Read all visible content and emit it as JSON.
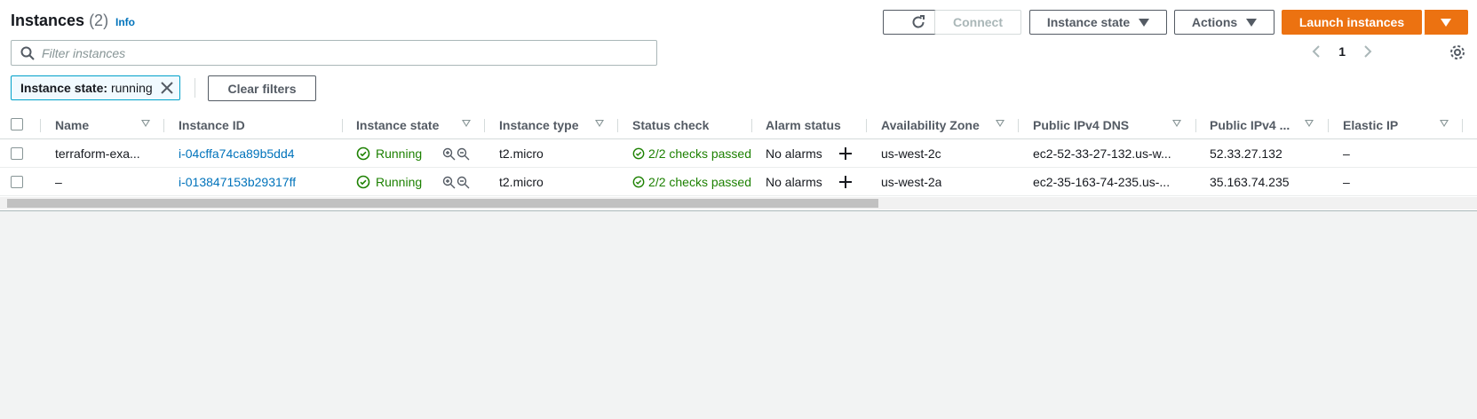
{
  "header": {
    "title": "Instances",
    "count": "(2)",
    "info": "Info"
  },
  "toolbar": {
    "connect": "Connect",
    "instance_state": "Instance state",
    "actions": "Actions",
    "launch": "Launch instances"
  },
  "search": {
    "placeholder": "Filter instances"
  },
  "pagination": {
    "page": "1"
  },
  "filter": {
    "key": "Instance state:",
    "value": "running",
    "clear": "Clear filters"
  },
  "columns": [
    "Name",
    "Instance ID",
    "Instance state",
    "Instance type",
    "Status check",
    "Alarm status",
    "Availability Zone",
    "Public IPv4 DNS",
    "Public IPv4 ...",
    "Elastic IP"
  ],
  "rows": [
    {
      "name": "terraform-exa...",
      "id": "i-04cffa74ca89b5dd4",
      "state": "Running",
      "type": "t2.micro",
      "status": "2/2 checks passed",
      "alarm": "No alarms",
      "az": "us-west-2c",
      "dns": "ec2-52-33-27-132.us-w...",
      "ip": "52.33.27.132",
      "eip": "–"
    },
    {
      "name": "–",
      "id": "i-013847153b29317ff",
      "state": "Running",
      "type": "t2.micro",
      "status": "2/2 checks passed",
      "alarm": "No alarms",
      "az": "us-west-2a",
      "dns": "ec2-35-163-74-235.us-...",
      "ip": "35.163.74.235",
      "eip": "–"
    }
  ],
  "colors": {
    "accent": "#ec7211",
    "link": "#0073bb",
    "success": "#1d8102"
  }
}
